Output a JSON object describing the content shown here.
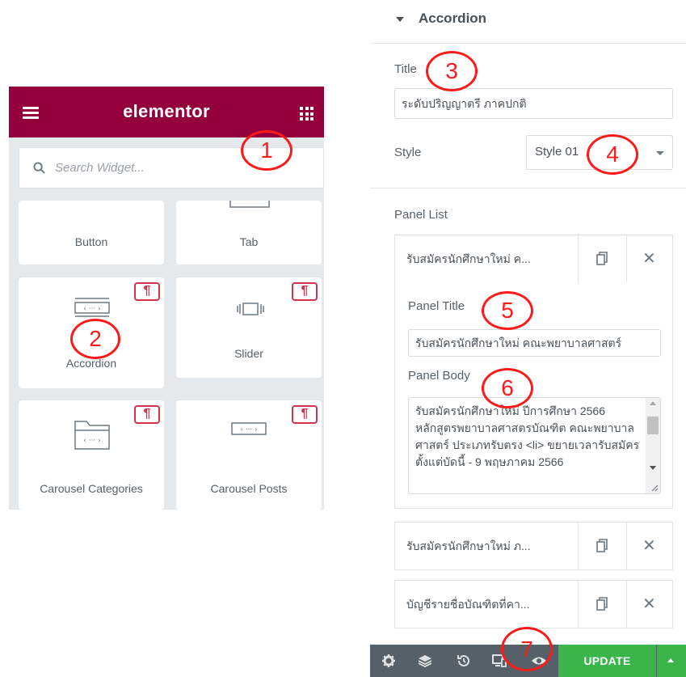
{
  "widget_panel": {
    "logo": "elementor",
    "search_placeholder": "Search Widget...",
    "widgets": [
      {
        "label": "Button",
        "pro": false
      },
      {
        "label": "Tab",
        "pro": false
      },
      {
        "label": "Accordion",
        "pro": true,
        "pro_glyph": "¶"
      },
      {
        "label": "Slider",
        "pro": true,
        "pro_glyph": "¶"
      },
      {
        "label": "Carousel Categories",
        "pro": true,
        "pro_glyph": "¶"
      },
      {
        "label": "Carousel Posts",
        "pro": true,
        "pro_glyph": "¶"
      }
    ]
  },
  "settings_panel": {
    "section_title": "Accordion",
    "title_label": "Title",
    "title_value": "ระดับปริญญาตรี ภาคปกติ",
    "style_label": "Style",
    "style_value": "Style 01",
    "panel_list_label": "Panel List",
    "panels": [
      {
        "title": "รับสมัครนักศึกษาใหม่ ค..."
      },
      {
        "title": "รับสมัครนักศึกษาใหม่ ภ..."
      },
      {
        "title": "บัญชีรายชื่อบัณฑิตที่คา..."
      }
    ],
    "panel_title_label": "Panel Title",
    "panel_title_value": "รับสมัครนักศึกษาใหม่ คณะพยาบาลศาสตร์",
    "panel_body_label": "Panel Body",
    "panel_body_value": "รับสมัครนักศึกษาใหม่ ปีการศึกษา 2566 หลักสูตรพยาบาลศาสตรบัณฑิต คณะพยาบาลศาสตร์ ประเภทรับตรง <li> ขยายเวลารับสมัครตั้งแต่บัดนี้ - 9 พฤษภาคม 2566"
  },
  "footer": {
    "update_label": "UPDATE"
  },
  "annotations": [
    "1",
    "2",
    "3",
    "4",
    "5",
    "6",
    "7"
  ],
  "colors": {
    "brand": "#93003c",
    "update": "#39b54a",
    "pro_badge": "#d0334a",
    "annotation": "#ff1a1a"
  }
}
